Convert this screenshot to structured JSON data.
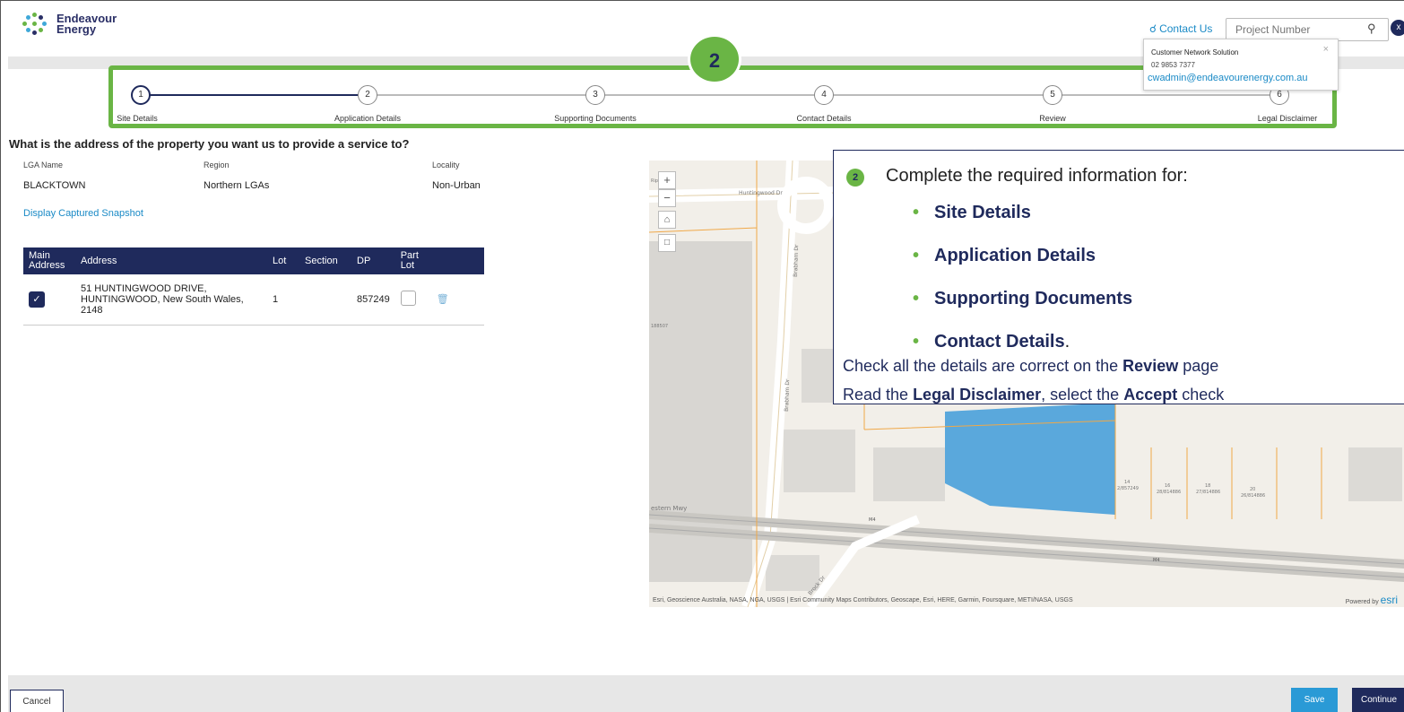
{
  "header": {
    "brand_line1": "Endeavour",
    "brand_line2": "Energy",
    "contact_label": "Contact Us",
    "search_placeholder": "Project Number",
    "close_glyph": "x"
  },
  "popup": {
    "title": "Customer Network Solution",
    "phone": "02 9853 7377",
    "email": "cwadmin@endeavourenergy.com.au"
  },
  "stepper": {
    "badge": "2",
    "steps": [
      {
        "num": "1",
        "label": "Site Details"
      },
      {
        "num": "2",
        "label": "Application Details"
      },
      {
        "num": "3",
        "label": "Supporting Documents"
      },
      {
        "num": "4",
        "label": "Contact Details"
      },
      {
        "num": "5",
        "label": "Review"
      },
      {
        "num": "6",
        "label": "Legal Disclaimer"
      }
    ]
  },
  "form": {
    "question": "What is the address of the property you want us to provide a service to?",
    "lga_label": "LGA Name",
    "lga_value": "BLACKTOWN",
    "region_label": "Region",
    "region_value": "Northern LGAs",
    "locality_label": "Locality",
    "locality_value": "Non-Urban",
    "snapshot_link": "Display Captured Snapshot"
  },
  "table": {
    "headers": [
      "Main Address",
      "Address",
      "Lot",
      "Section",
      "DP",
      "Part Lot"
    ],
    "row": {
      "address": "51 HUNTINGWOOD DRIVE, HUNTINGWOOD, New South Wales, 2148",
      "lot": "1",
      "section": "",
      "dp": "857249"
    }
  },
  "map": {
    "attribution": "Esri, Geoscience Australia, NASA, NGA, USGS | Esri Community Maps Contributors, Geoscape, Esri, HERE, Garmin, Foursquare, METI/NASA, USGS",
    "powered": "Powered by",
    "esri": "esri",
    "labels": {
      "huntingwood": "Huntingwood Dr",
      "brabham": "Brabham Dr",
      "western": "estern Mwy",
      "m4a": "M4",
      "m4b": "M4",
      "brock": "Brock Dr",
      "lot_left": "188507",
      "lot_a": "14",
      "lot_a2": "2/857249",
      "lot_b": "16",
      "lot_b2": "28/814886",
      "lot_c": "18",
      "lot_c2": "27/814886",
      "lot_d": "20",
      "lot_d2": "26/814886",
      "top_left": "Ripe"
    }
  },
  "callout": {
    "num": "2",
    "intro": "Complete the required information for:",
    "items": [
      "Site Details",
      "Application Details",
      "Supporting Documents",
      "Contact Details"
    ],
    "item_suffix": ".",
    "check_pre": "Check all the details are correct on the ",
    "check_bold": "Review",
    "check_post": " page",
    "read_pre": "Read the ",
    "read_bold1": "Legal Disclaimer",
    "read_mid": ", select the ",
    "read_bold2": "Accept",
    "read_post": " check"
  },
  "footer": {
    "cancel": "Cancel",
    "save": "Save",
    "continue": "Continue"
  },
  "colors": {
    "navy": "#1f2a5c",
    "green": "#6ab545",
    "link": "#1a8ac6",
    "water": "#5aa8dc"
  }
}
